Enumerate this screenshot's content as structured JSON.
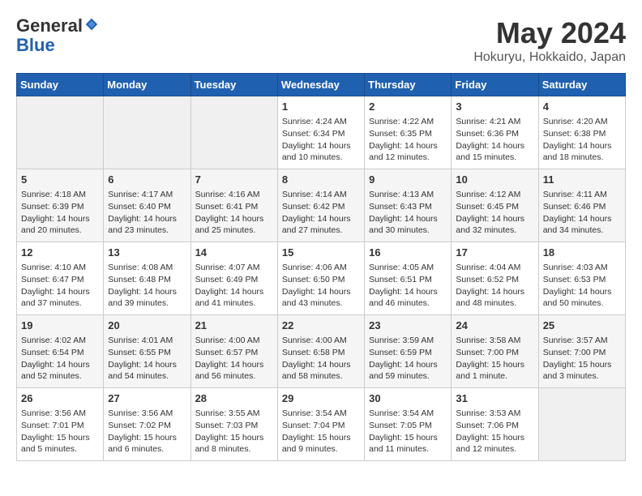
{
  "header": {
    "logo_general": "General",
    "logo_blue": "Blue",
    "month": "May 2024",
    "location": "Hokuryu, Hokkaido, Japan"
  },
  "days_of_week": [
    "Sunday",
    "Monday",
    "Tuesday",
    "Wednesday",
    "Thursday",
    "Friday",
    "Saturday"
  ],
  "weeks": [
    [
      {
        "day": "",
        "info": ""
      },
      {
        "day": "",
        "info": ""
      },
      {
        "day": "",
        "info": ""
      },
      {
        "day": "1",
        "info": "Sunrise: 4:24 AM\nSunset: 6:34 PM\nDaylight: 14 hours\nand 10 minutes."
      },
      {
        "day": "2",
        "info": "Sunrise: 4:22 AM\nSunset: 6:35 PM\nDaylight: 14 hours\nand 12 minutes."
      },
      {
        "day": "3",
        "info": "Sunrise: 4:21 AM\nSunset: 6:36 PM\nDaylight: 14 hours\nand 15 minutes."
      },
      {
        "day": "4",
        "info": "Sunrise: 4:20 AM\nSunset: 6:38 PM\nDaylight: 14 hours\nand 18 minutes."
      }
    ],
    [
      {
        "day": "5",
        "info": "Sunrise: 4:18 AM\nSunset: 6:39 PM\nDaylight: 14 hours\nand 20 minutes."
      },
      {
        "day": "6",
        "info": "Sunrise: 4:17 AM\nSunset: 6:40 PM\nDaylight: 14 hours\nand 23 minutes."
      },
      {
        "day": "7",
        "info": "Sunrise: 4:16 AM\nSunset: 6:41 PM\nDaylight: 14 hours\nand 25 minutes."
      },
      {
        "day": "8",
        "info": "Sunrise: 4:14 AM\nSunset: 6:42 PM\nDaylight: 14 hours\nand 27 minutes."
      },
      {
        "day": "9",
        "info": "Sunrise: 4:13 AM\nSunset: 6:43 PM\nDaylight: 14 hours\nand 30 minutes."
      },
      {
        "day": "10",
        "info": "Sunrise: 4:12 AM\nSunset: 6:45 PM\nDaylight: 14 hours\nand 32 minutes."
      },
      {
        "day": "11",
        "info": "Sunrise: 4:11 AM\nSunset: 6:46 PM\nDaylight: 14 hours\nand 34 minutes."
      }
    ],
    [
      {
        "day": "12",
        "info": "Sunrise: 4:10 AM\nSunset: 6:47 PM\nDaylight: 14 hours\nand 37 minutes."
      },
      {
        "day": "13",
        "info": "Sunrise: 4:08 AM\nSunset: 6:48 PM\nDaylight: 14 hours\nand 39 minutes."
      },
      {
        "day": "14",
        "info": "Sunrise: 4:07 AM\nSunset: 6:49 PM\nDaylight: 14 hours\nand 41 minutes."
      },
      {
        "day": "15",
        "info": "Sunrise: 4:06 AM\nSunset: 6:50 PM\nDaylight: 14 hours\nand 43 minutes."
      },
      {
        "day": "16",
        "info": "Sunrise: 4:05 AM\nSunset: 6:51 PM\nDaylight: 14 hours\nand 46 minutes."
      },
      {
        "day": "17",
        "info": "Sunrise: 4:04 AM\nSunset: 6:52 PM\nDaylight: 14 hours\nand 48 minutes."
      },
      {
        "day": "18",
        "info": "Sunrise: 4:03 AM\nSunset: 6:53 PM\nDaylight: 14 hours\nand 50 minutes."
      }
    ],
    [
      {
        "day": "19",
        "info": "Sunrise: 4:02 AM\nSunset: 6:54 PM\nDaylight: 14 hours\nand 52 minutes."
      },
      {
        "day": "20",
        "info": "Sunrise: 4:01 AM\nSunset: 6:55 PM\nDaylight: 14 hours\nand 54 minutes."
      },
      {
        "day": "21",
        "info": "Sunrise: 4:00 AM\nSunset: 6:57 PM\nDaylight: 14 hours\nand 56 minutes."
      },
      {
        "day": "22",
        "info": "Sunrise: 4:00 AM\nSunset: 6:58 PM\nDaylight: 14 hours\nand 58 minutes."
      },
      {
        "day": "23",
        "info": "Sunrise: 3:59 AM\nSunset: 6:59 PM\nDaylight: 14 hours\nand 59 minutes."
      },
      {
        "day": "24",
        "info": "Sunrise: 3:58 AM\nSunset: 7:00 PM\nDaylight: 15 hours\nand 1 minute."
      },
      {
        "day": "25",
        "info": "Sunrise: 3:57 AM\nSunset: 7:00 PM\nDaylight: 15 hours\nand 3 minutes."
      }
    ],
    [
      {
        "day": "26",
        "info": "Sunrise: 3:56 AM\nSunset: 7:01 PM\nDaylight: 15 hours\nand 5 minutes."
      },
      {
        "day": "27",
        "info": "Sunrise: 3:56 AM\nSunset: 7:02 PM\nDaylight: 15 hours\nand 6 minutes."
      },
      {
        "day": "28",
        "info": "Sunrise: 3:55 AM\nSunset: 7:03 PM\nDaylight: 15 hours\nand 8 minutes."
      },
      {
        "day": "29",
        "info": "Sunrise: 3:54 AM\nSunset: 7:04 PM\nDaylight: 15 hours\nand 9 minutes."
      },
      {
        "day": "30",
        "info": "Sunrise: 3:54 AM\nSunset: 7:05 PM\nDaylight: 15 hours\nand 11 minutes."
      },
      {
        "day": "31",
        "info": "Sunrise: 3:53 AM\nSunset: 7:06 PM\nDaylight: 15 hours\nand 12 minutes."
      },
      {
        "day": "",
        "info": ""
      }
    ]
  ]
}
